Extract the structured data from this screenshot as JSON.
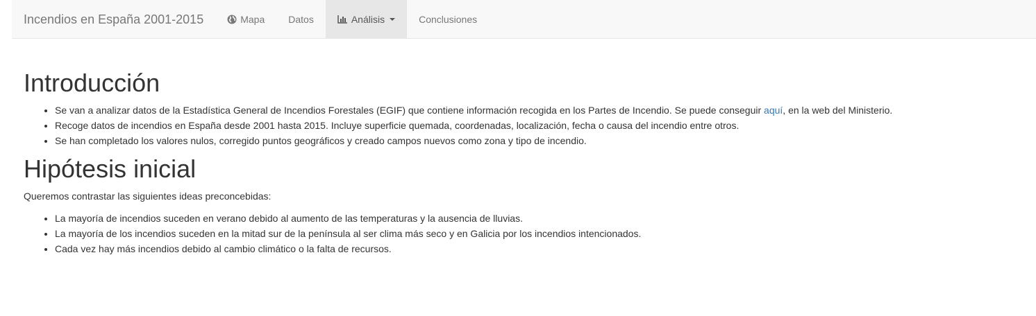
{
  "navbar": {
    "brand": "Incendios en España 2001-2015",
    "items": [
      {
        "label": "Mapa",
        "icon": "globe-icon"
      },
      {
        "label": "Datos"
      },
      {
        "label": "Análisis",
        "icon": "bar-chart-icon",
        "active": true,
        "dropdown": true
      },
      {
        "label": "Conclusiones"
      }
    ]
  },
  "intro": {
    "title": "Introducción",
    "b1_pre": "Se van a analizar datos de la Estadística General de Incendios Forestales (EGIF) que contiene información recogida en los Partes de Incendio. Se puede conseguir ",
    "b1_link": "aquí",
    "b1_post": ", en la web del Ministerio.",
    "b2": "Recoge datos de incendios en España desde 2001 hasta 2015. Incluye superficie quemada, coordenadas, localización, fecha o causa del incendio entre otros.",
    "b3": "Se han completado los valores nulos, corregido puntos geográficos y creado campos nuevos como zona y tipo de incendio."
  },
  "hypothesis": {
    "title": "Hipótesis inicial",
    "lead": "Queremos contrastar las siguientes ideas preconcebidas:",
    "items": [
      "La mayoría de incendios suceden en verano debido al aumento de las temperaturas y la ausencia de lluvias.",
      "La mayoría de los incendios suceden en la mitad sur de la península al ser clima más seco y en Galicia por los incendios intencionados.",
      "Cada vez hay más incendios debido al cambio climático o la falta de recursos."
    ]
  }
}
